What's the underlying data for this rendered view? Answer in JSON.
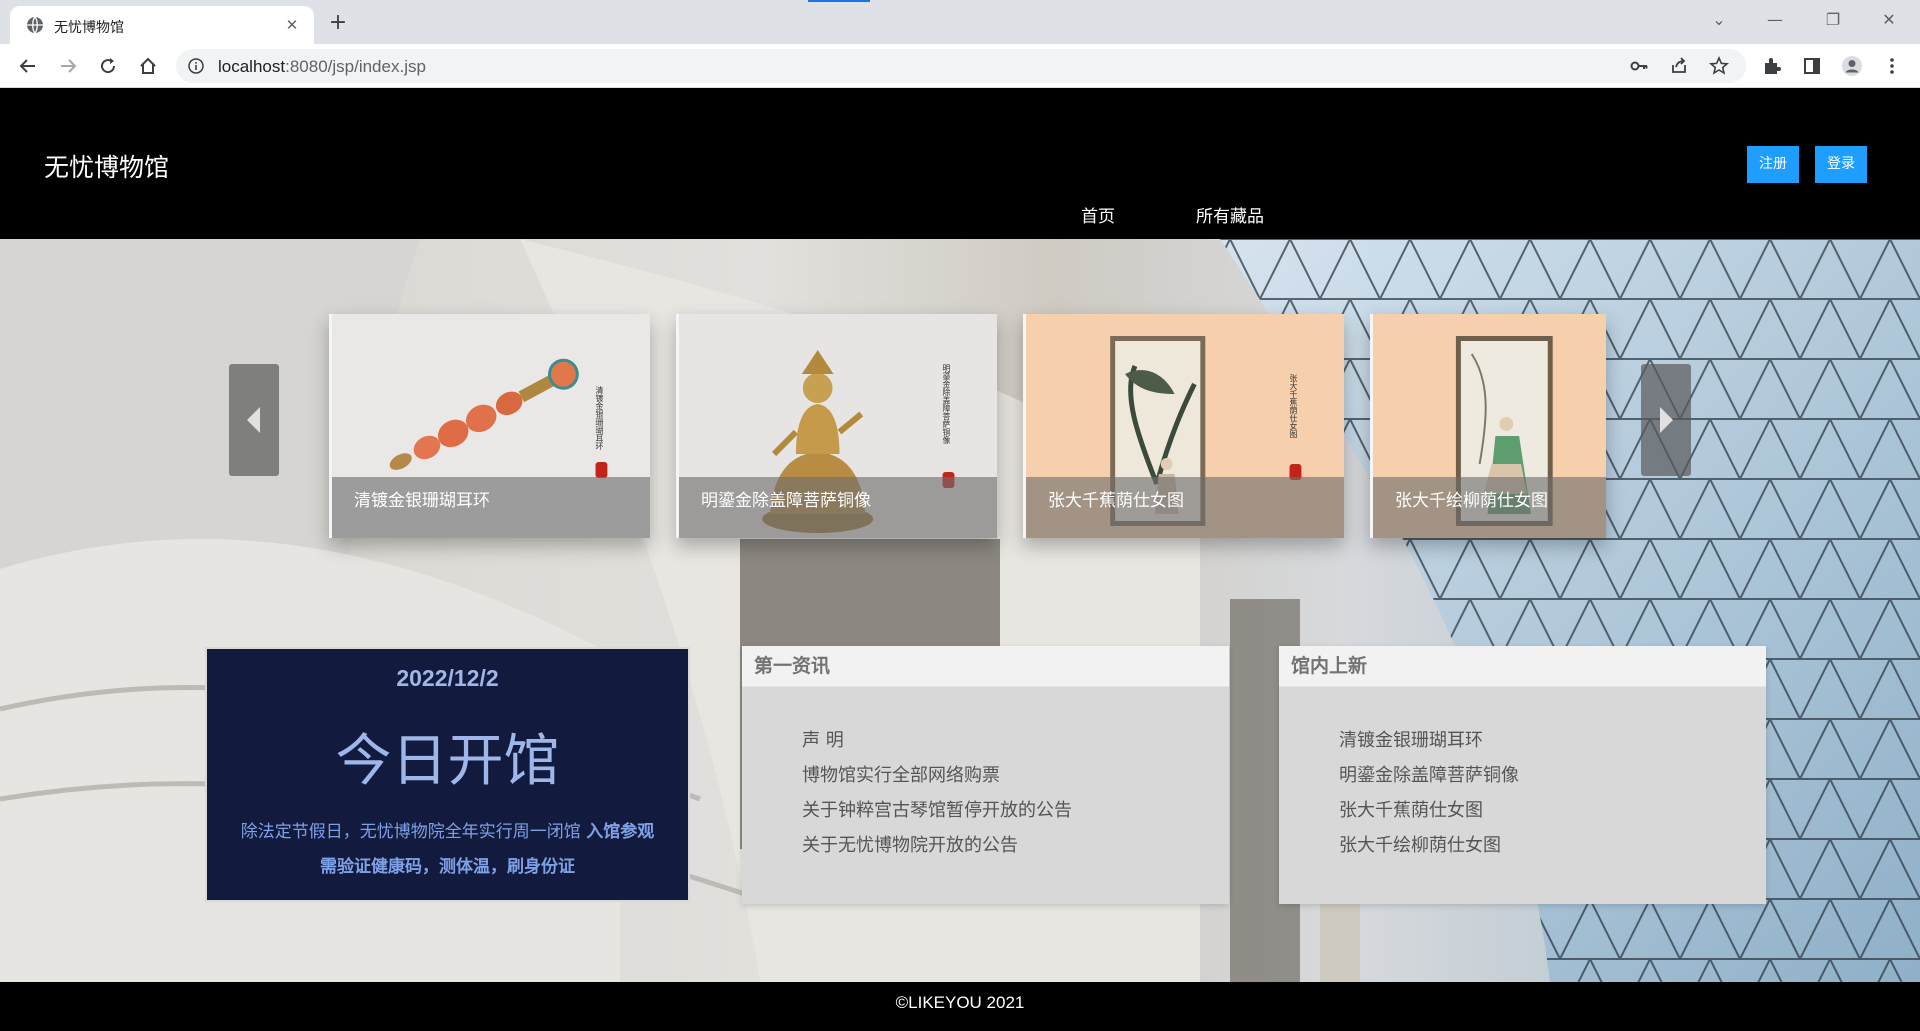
{
  "browser": {
    "tab_title": "无忧博物馆",
    "tab_close": "✕",
    "new_tab": "+",
    "url_host": "localhost",
    "url_rest": ":8080/jsp/index.jsp",
    "window_controls": {
      "minimize": "—",
      "restore": "❐",
      "close": "✕",
      "tab_search": "⌄"
    }
  },
  "site": {
    "logo": "无忧博物馆",
    "register_label": "注册",
    "login_label": "登录",
    "nav": [
      "首页",
      "所有藏品"
    ],
    "accent_color": "#1e9fff"
  },
  "carousel": {
    "items": [
      {
        "caption": "清镀金银珊瑚耳环"
      },
      {
        "caption": "明鎏金除盖障菩萨铜像"
      },
      {
        "caption": "张大千蕉荫仕女图"
      },
      {
        "caption": "张大千绘柳荫仕女图"
      }
    ]
  },
  "today": {
    "date": "2022/12/2",
    "status": "今日开馆",
    "notice_plain": "除法定节假日，无忧博物院全年实行周一闭馆 ",
    "notice_bold": "入馆参观需验证健康码，测体温，刷身份证"
  },
  "news": {
    "title": "第一资讯",
    "items": [
      "声 明",
      "博物馆实行全部网络购票",
      "关于钟粹宫古琴馆暂停开放的公告",
      "关于无忧博物院开放的公告"
    ]
  },
  "new_arrivals": {
    "title": "馆内上新",
    "items": [
      "清镀金银珊瑚耳环",
      "明鎏金除盖障菩萨铜像",
      "张大千蕉荫仕女图",
      "张大千绘柳荫仕女图"
    ]
  },
  "footer": {
    "text": "©LIKEYOU 2021"
  }
}
